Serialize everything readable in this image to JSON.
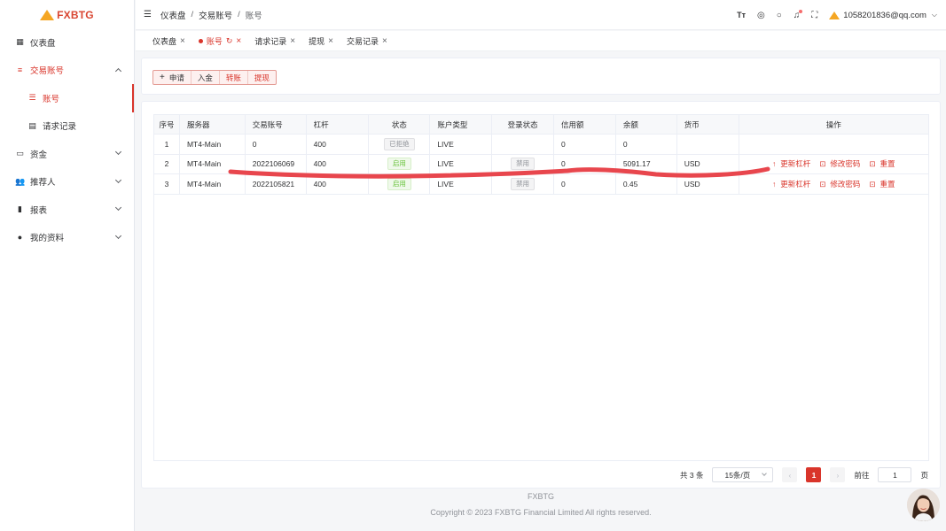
{
  "brand": {
    "name": "FXBTG"
  },
  "sidebar": {
    "items": [
      {
        "icon": "dashboard-icon",
        "glyph": "▦",
        "label": "仪表盘"
      },
      {
        "icon": "menu-list-icon",
        "glyph": "≡",
        "label": "交易账号"
      },
      {
        "icon": "list-icon",
        "glyph": "☰",
        "label": "账号"
      },
      {
        "icon": "document-icon",
        "glyph": "▤",
        "label": "请求记录"
      },
      {
        "icon": "card-icon",
        "glyph": "▭",
        "label": "资金"
      },
      {
        "icon": "people-icon",
        "glyph": "👥",
        "label": "推荐人"
      },
      {
        "icon": "bar-chart-icon",
        "glyph": "▮",
        "label": "报表"
      },
      {
        "icon": "user-icon",
        "glyph": "●",
        "label": "我的资料"
      }
    ]
  },
  "header": {
    "breadcrumb": [
      "仪表盘",
      "交易账号",
      "账号"
    ],
    "icons": [
      "font-size-icon",
      "target-icon",
      "search-icon",
      "bell-icon",
      "fullscreen-icon"
    ],
    "user_email": "1058201836@qq.com"
  },
  "tabs": [
    {
      "label": "仪表盘"
    },
    {
      "label": "账号"
    },
    {
      "label": "请求记录"
    },
    {
      "label": "提现"
    },
    {
      "label": "交易记录"
    }
  ],
  "actions": {
    "apply": "申请",
    "deposit": "入金",
    "transfer": "转账",
    "withdraw": "提现"
  },
  "table": {
    "headers": [
      "序号",
      "服务器",
      "交易账号",
      "杠杆",
      "状态",
      "账户类型",
      "登录状态",
      "信用额",
      "余额",
      "货币",
      "操作"
    ],
    "rows": [
      {
        "no": "1",
        "server": "MT4-Main",
        "account": "0",
        "leverage": "400",
        "status": "已拒绝",
        "type": "LIVE",
        "login": "",
        "credit": "0",
        "balance": "0",
        "currency": ""
      },
      {
        "no": "2",
        "server": "MT4-Main",
        "account": "2022106069",
        "leverage": "400",
        "status": "启用",
        "type": "LIVE",
        "login": "禁用",
        "credit": "0",
        "balance": "5091.17",
        "currency": "USD"
      },
      {
        "no": "3",
        "server": "MT4-Main",
        "account": "2022105821",
        "leverage": "400",
        "status": "启用",
        "type": "LIVE",
        "login": "禁用",
        "credit": "0",
        "balance": "0.45",
        "currency": "USD"
      }
    ],
    "ops": {
      "leverage": "更新杠杆",
      "password": "修改密码",
      "reset": "重置"
    }
  },
  "pagination": {
    "total": "共 3 条",
    "page_size": "15条/页",
    "current": "1",
    "goto_label": "前往",
    "goto_value": "1",
    "page_unit": "页"
  },
  "footer": {
    "brand": "FXBTG",
    "copyright": "Copyright © 2023 FXBTG Financial Limited All rights reserved."
  },
  "colors": {
    "accent": "#d9352b",
    "logo_yellow": "#f5a623",
    "scribble": "#e8464d"
  }
}
